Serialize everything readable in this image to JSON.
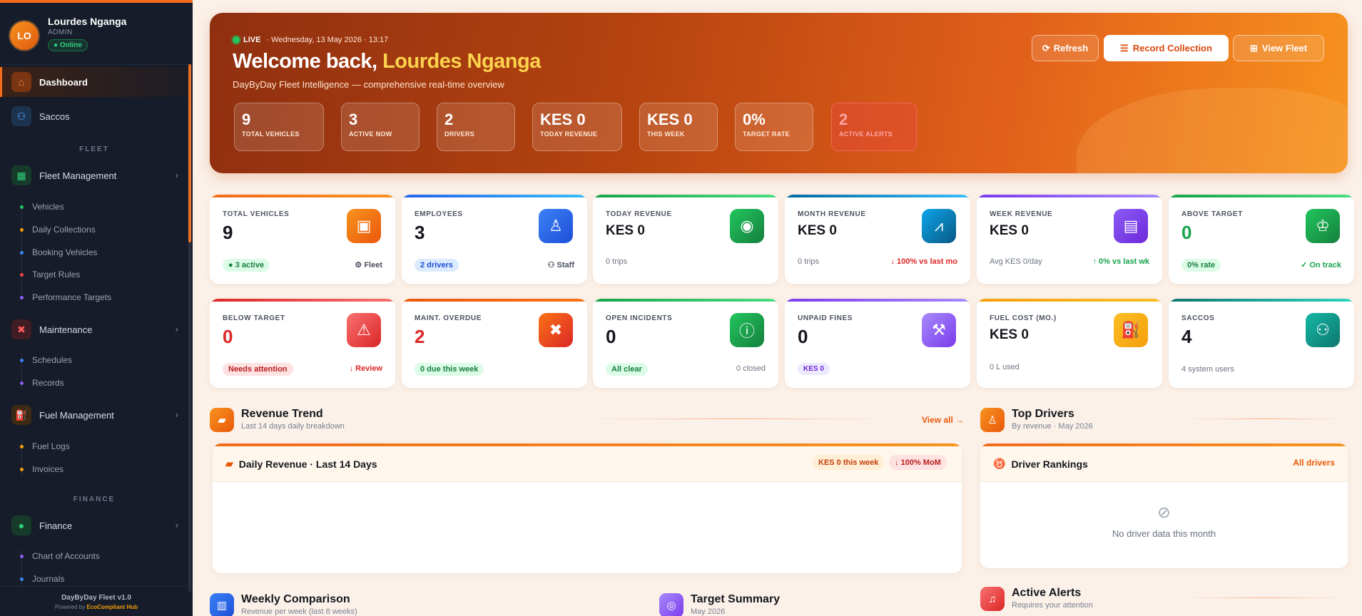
{
  "user": {
    "initials": "LO",
    "name": "Lourdes Nganga",
    "role": "ADMIN",
    "status": "● Online"
  },
  "nav": {
    "dashboard": "Dashboard",
    "saccos": "Saccos",
    "section_fleet": "FLEET",
    "fleet_management": "Fleet Management",
    "fleet_items": [
      "Vehicles",
      "Daily Collections",
      "Booking Vehicles",
      "Target Rules",
      "Performance Targets"
    ],
    "maintenance": "Maintenance",
    "maintenance_items": [
      "Schedules",
      "Records"
    ],
    "fuel_management": "Fuel Management",
    "fuel_items": [
      "Fuel Logs",
      "Invoices"
    ],
    "section_finance": "FINANCE",
    "finance": "Finance",
    "finance_items": [
      "Chart of Accounts",
      "Journals"
    ]
  },
  "footer": {
    "version": "DayByDay Fleet v1.0",
    "powered_prefix": "Powered by ",
    "powered_brand": "EcoCompliant Hub"
  },
  "hero": {
    "live": "LIVE",
    "datetime": "· Wednesday, 13 May 2026 · 13:17",
    "welcome_prefix": "Welcome back, ",
    "welcome_name": "Lourdes Nganga",
    "tagline": "DayByDay Fleet Intelligence — comprehensive real-time overview",
    "buttons": {
      "refresh": "Refresh",
      "record": "Record Collection",
      "view_fleet": "View Fleet"
    },
    "stats": [
      {
        "value": "9",
        "label": "TOTAL VEHICLES"
      },
      {
        "value": "3",
        "label": "ACTIVE NOW"
      },
      {
        "value": "2",
        "label": "DRIVERS"
      },
      {
        "value": "KES 0",
        "label": "TODAY REVENUE"
      },
      {
        "value": "KES 0",
        "label": "THIS WEEK"
      },
      {
        "value": "0%",
        "label": "TARGET RATE"
      },
      {
        "value": "2",
        "label": "ACTIVE ALERTS"
      }
    ]
  },
  "cards_row1": [
    {
      "title": "TOTAL VEHICLES",
      "value": "9",
      "pill": "● 3 active",
      "right": "⚙ Fleet"
    },
    {
      "title": "EMPLOYEES",
      "value": "3",
      "pill": "2 drivers",
      "right": "⚇ Staff"
    },
    {
      "title": "TODAY REVENUE",
      "value": "KES 0",
      "foot": "0 trips"
    },
    {
      "title": "MONTH REVENUE",
      "value": "KES 0",
      "foot": "0 trips",
      "right": "↓ 100% vs last mo"
    },
    {
      "title": "WEEK REVENUE",
      "value": "KES 0",
      "foot": "Avg KES 0/day",
      "right": "↑ 0% vs last wk"
    },
    {
      "title": "ABOVE TARGET",
      "value": "0",
      "pill": "0% rate",
      "right": "✓ On track"
    }
  ],
  "cards_row2": [
    {
      "title": "BELOW TARGET",
      "value": "0",
      "pill": "Needs attention",
      "right": "↓ Review"
    },
    {
      "title": "MAINT. OVERDUE",
      "value": "2",
      "pill": "0 due this week"
    },
    {
      "title": "OPEN INCIDENTS",
      "value": "0",
      "pill": "All clear",
      "right": "0 closed"
    },
    {
      "title": "UNPAID FINES",
      "value": "0",
      "pill": "KES 0"
    },
    {
      "title": "FUEL COST (MO.)",
      "value": "KES 0",
      "foot": "0 L used"
    },
    {
      "title": "SACCOS",
      "value": "4",
      "foot": "4 system users"
    }
  ],
  "revenue": {
    "title": "Revenue Trend",
    "subtitle": "Last 14 days daily breakdown",
    "view_all": "View all →",
    "panel_title": "Daily Revenue · Last 14 Days",
    "chip_week": "KES 0 this week",
    "chip_mom": "↓ 100% MoM"
  },
  "drivers": {
    "title": "Top Drivers",
    "subtitle": "By revenue · May 2026",
    "panel_title": "Driver Rankings",
    "all": "All drivers",
    "empty": "No driver data this month"
  },
  "weekly": {
    "title": "Weekly Comparison",
    "subtitle": "Revenue per week (last 8 weeks)"
  },
  "target": {
    "title": "Target Summary",
    "subtitle": "May 2026"
  },
  "alerts": {
    "title": "Active Alerts",
    "subtitle": "Requires your attention"
  },
  "colors": {
    "accent": "#f26a1b",
    "sidebar": "#161c29",
    "page": "#fbf1e9"
  }
}
